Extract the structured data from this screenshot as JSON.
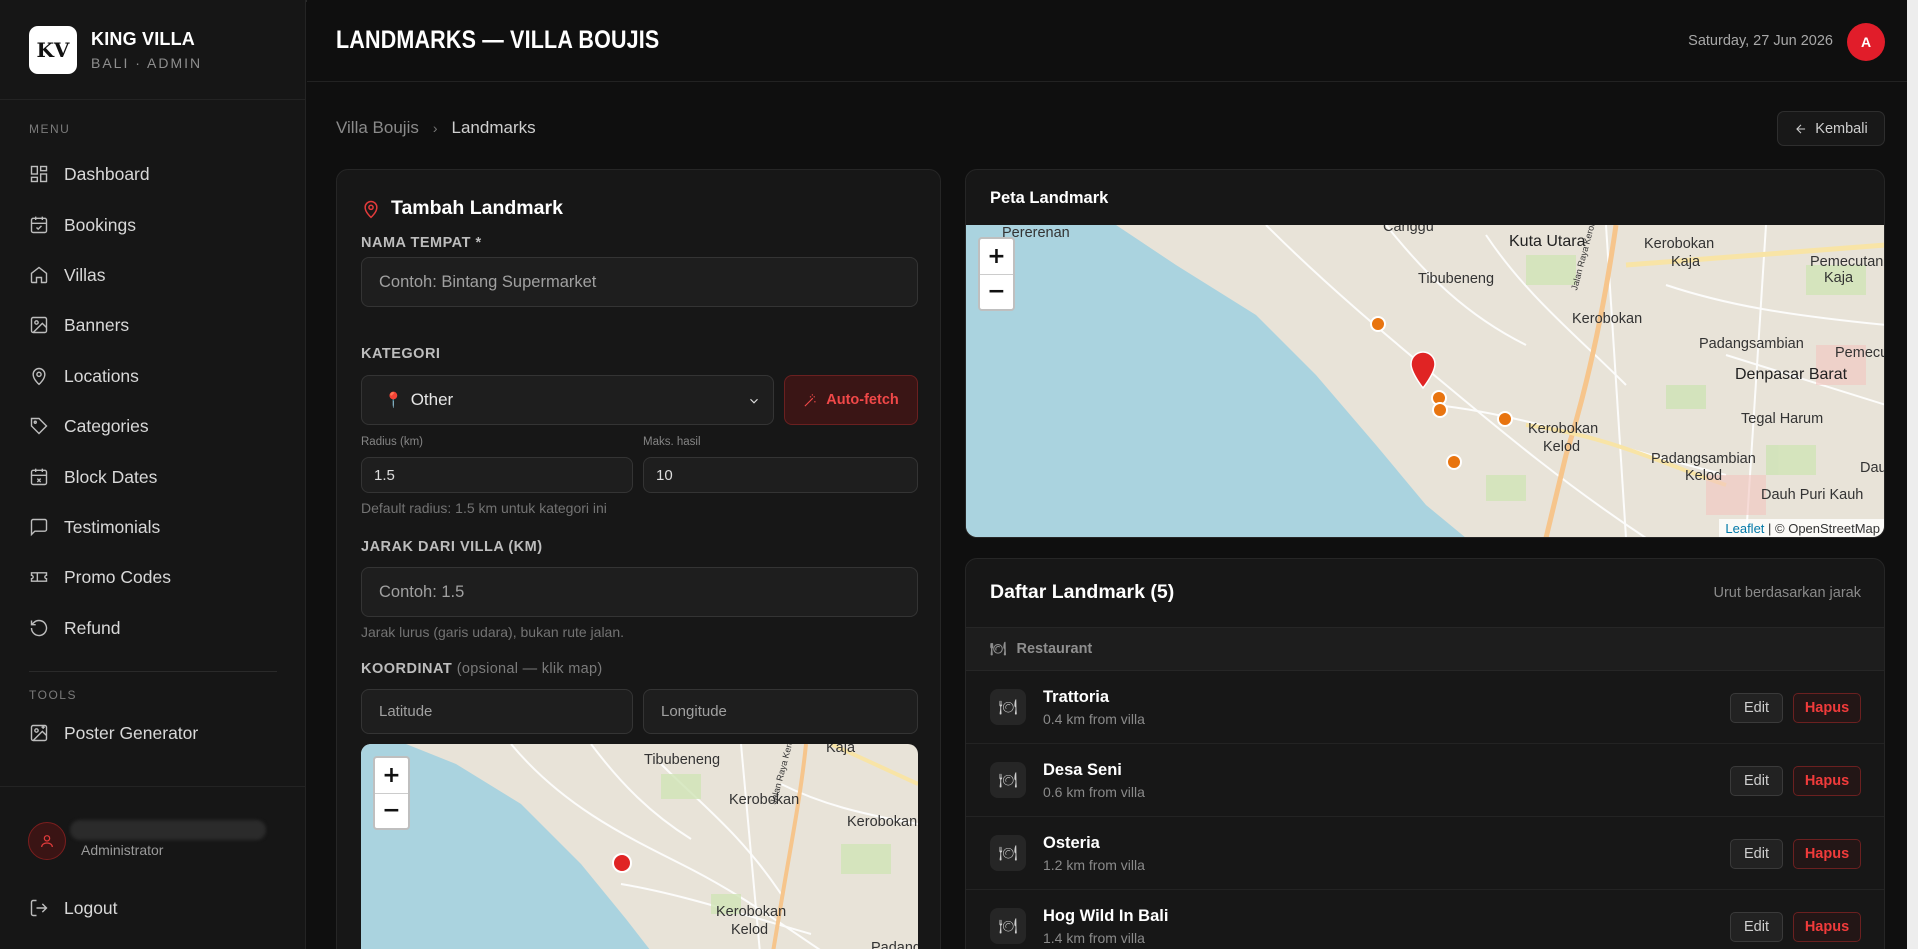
{
  "brand": {
    "name": "KING VILLA",
    "subtitle": "BALI · ADMIN",
    "logo_text": "KV"
  },
  "sidebar": {
    "menu_label": "MENU",
    "items": [
      {
        "label": "Dashboard",
        "icon": "dashboard-icon"
      },
      {
        "label": "Bookings",
        "icon": "calendar-check-icon"
      },
      {
        "label": "Villas",
        "icon": "home-icon"
      },
      {
        "label": "Banners",
        "icon": "image-icon"
      },
      {
        "label": "Locations",
        "icon": "map-pin-icon"
      },
      {
        "label": "Categories",
        "icon": "tag-icon"
      },
      {
        "label": "Block Dates",
        "icon": "calendar-x-icon"
      },
      {
        "label": "Testimonials",
        "icon": "message-icon"
      },
      {
        "label": "Promo Codes",
        "icon": "ticket-icon"
      },
      {
        "label": "Refund",
        "icon": "refund-icon"
      }
    ],
    "tools_label": "TOOLS",
    "tools": [
      {
        "label": "Poster Generator",
        "icon": "image-plus-icon"
      }
    ],
    "user": {
      "role": "Administrator"
    },
    "logout_label": "Logout"
  },
  "header": {
    "title": "LANDMARKS — VILLA BOUJIS",
    "date": "Saturday, 27 Jun 2026",
    "avatar_initial": "A"
  },
  "breadcrumb": {
    "parent": "Villa Boujis",
    "current": "Landmarks"
  },
  "back_button": "Kembali",
  "form": {
    "title": "Tambah Landmark",
    "name_label": "NAMA TEMPAT *",
    "name_placeholder": "Contoh: Bintang Supermarket",
    "category_label": "KATEGORI",
    "category_value": "Other",
    "autofetch_label": "Auto-fetch",
    "radius_label": "Radius (km)",
    "radius_value": "1.5",
    "max_label": "Maks. hasil",
    "max_value": "10",
    "radius_hint": "Default radius: 1.5 km untuk kategori ini",
    "distance_label": "JARAK DARI VILLA (KM)",
    "distance_placeholder": "Contoh: 1.5",
    "distance_hint": "Jarak lurus (garis udara), bukan rute jalan.",
    "coord_label": "KOORDINAT",
    "coord_optional": "(opsional — klik map)",
    "lat_placeholder": "Latitude",
    "lng_placeholder": "Longitude",
    "map_labels": [
      "Kaja",
      "Tibubeneng",
      "Kerobokan",
      "Jalan Raya Kerobokan",
      "Kerobokan",
      "Kelod",
      "Padangs"
    ]
  },
  "map_card": {
    "title": "Peta Landmark",
    "labels": [
      "Pererenan",
      "Canggu",
      "Kuta Utara",
      "Kerobokan",
      "Kaja",
      "Pemecutan",
      "Kaja",
      "Tibubeneng",
      "Kerobokan",
      "Padangsambian",
      "Pemecu",
      "Denpasar Barat",
      "Tegal Harum",
      "Kerobokan",
      "Kelod",
      "Padangsambian",
      "Kelod",
      "Dauh",
      "Dauh Puri Kauh",
      "Jalan Raya Kerobokan"
    ],
    "attribution_leaflet": "Leaflet",
    "attribution_osm": " | © OpenStreetMap"
  },
  "zoom": {
    "in": "+",
    "out": "−"
  },
  "list": {
    "title": "Daftar Landmark (5)",
    "sort_label": "Urut berdasarkan jarak",
    "category": "Restaurant",
    "items": [
      {
        "name": "Trattoria",
        "distance": "0.4 km from villa"
      },
      {
        "name": "Desa Seni",
        "distance": "0.6 km from villa"
      },
      {
        "name": "Osteria",
        "distance": "1.2 km from villa"
      },
      {
        "name": "Hog Wild In Bali",
        "distance": "1.4 km from villa"
      }
    ],
    "edit_label": "Edit",
    "delete_label": "Hapus"
  }
}
